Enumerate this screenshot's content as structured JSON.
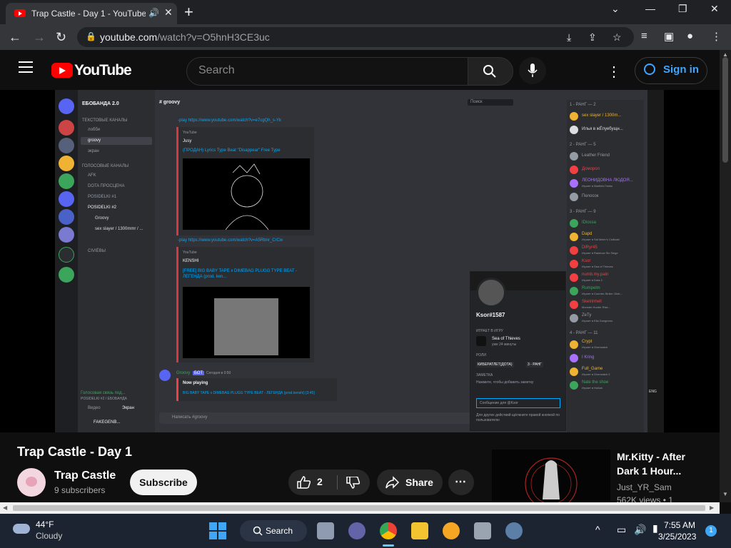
{
  "browser": {
    "tab_title": "Trap Castle - Day 1 - YouTube",
    "url_host": "youtube.com",
    "url_path": "/watch?v=O5hnH3CE3uc"
  },
  "youtube": {
    "logo_text": "YouTube",
    "search_placeholder": "Search",
    "signin_label": "Sign in"
  },
  "discord": {
    "server_name": "ЕБОБАНДА 2.0",
    "current_channel": "groovy",
    "text_category": "ТЕКСТОВЫЕ КАНАЛЫ",
    "text_channels": [
      "лобби",
      "groovy",
      "экран"
    ],
    "voice_category": "ГОЛОСОВЫЕ КАНАЛЫ",
    "voice_channels": [
      "AFK",
      "DOTA ПРОСЦЕНА",
      "POSIDELKI #1",
      "POSIDELKI #2"
    ],
    "voice_users": [
      "Groovy",
      "sex slayer / 1300mmr / ..."
    ],
    "voice_extra": "CIVIЁВЫ",
    "voice_status": "Голосовая связь под...",
    "voice_status_sub": "POSIDELKI #2 / ЕБОБАНДА",
    "video_btn": "Видео",
    "screen_btn": "Экран",
    "user_tag": "FAKEGENB...",
    "search_placeholder": "Поиск",
    "msg1_link": "-play https://www.youtube.com/watch?v=e7cgQh_s-Yk",
    "embed1_provider": "YouTube",
    "embed1_author": "Jusy",
    "embed1_title": "(ПРОДАН) Lyrics Type Beat \"Disappear\" Free Type",
    "msg2_link": "-play https://www.youtube.com/watch?v=A5Rbnr_CrCw",
    "embed2_provider": "YouTube",
    "embed2_author": "KENSHI",
    "embed2_title": "[FREE] BIG BABY TAPE x DIMEBAG PLUGG TYPE BEAT - ЛЕГЕНДА (prod. ken...",
    "bot_name": "Groovy",
    "bot_badge": "БОТ",
    "bot_time": "Сегодня в 0:50",
    "now_playing_label": "Now playing",
    "now_playing_track": "BIG BABY TAPE x DIMEBAG PLUGG TYPE BEAT - ЛЕГЕНДА (prod.kenshi) [3:45]",
    "input_placeholder": "Написать #groovy",
    "members_groups": [
      {
        "title": "1 - РАНГ — 2",
        "members": [
          {
            "name": "sex slayer / 1300m...",
            "color": "#f0b232",
            "activity": ""
          },
          {
            "name": "Илья в жЁпуебущн...",
            "color": "#dbdee1",
            "activity": ""
          }
        ]
      },
      {
        "title": "2 - РАНГ — 5",
        "members": [
          {
            "name": "Leather Friend",
            "color": "#949ba4",
            "activity": ""
          },
          {
            "name": "Доморол",
            "color": "#f23f42",
            "activity": ""
          },
          {
            "name": "ЛЕОНИДОВНА ЛЮДОЯ...",
            "color": "#a970ff",
            "activity": "Играет в Warfield Tanks"
          },
          {
            "name": "Пелосок",
            "color": "#949ba4",
            "activity": ""
          }
        ]
      },
      {
        "title": "3 - РАНГ — 9",
        "members": [
          {
            "name": "IDiossa",
            "color": "#3ba55c",
            "activity": ""
          },
          {
            "name": "Dapd",
            "color": "#f0b232",
            "activity": "Играет в Sid Meier's Civilizati"
          },
          {
            "name": "DiRyr45",
            "color": "#f23f42",
            "activity": "Играет в Rainbow Six Siege"
          },
          {
            "name": "Ksor",
            "color": "#f23f42",
            "activity": "Играет в Sea of Thieves"
          },
          {
            "name": "numb.my.pain",
            "color": "#f23f42",
            "activity": "Играет в Dota 2"
          },
          {
            "name": "Rumpelm",
            "color": "#3ba55c",
            "activity": "Играет в Counter-Strike: Glob..."
          },
          {
            "name": "Skelrinhell",
            "color": "#f23f42",
            "activity": "Monster Hunter Rise..."
          },
          {
            "name": "ZeTy",
            "color": "#949ba4",
            "activity": "Играет в Ella Dungeons"
          }
        ]
      },
      {
        "title": "4 - РАНГ — 11",
        "members": [
          {
            "name": "Crypt",
            "color": "#f0b232",
            "activity": "Играет в Overwatch"
          },
          {
            "name": "I Kring",
            "color": "#a970ff",
            "activity": ""
          },
          {
            "name": "Full_Game",
            "color": "#f0b232",
            "activity": "Играет в Overwatch 2"
          },
          {
            "name": "Nate the shoe",
            "color": "#3ba55c",
            "activity": "Играет в Hollow"
          }
        ]
      }
    ],
    "profile": {
      "username": "Ksor#1587",
      "playing_header": "ИГРАЕТ В ИГРУ",
      "game": "Sea of Thieves",
      "game_time": "уже 24 минуты",
      "roles_header": "РОЛИ",
      "roles": [
        "КИБЕРАТЛЕТ(ДОТА)",
        "3 - РАНГ"
      ],
      "note_header": "ЗАМЕТКА",
      "note_placeholder": "Нажмите, чтобы добавить заметку",
      "message_placeholder": "Сообщение для @Ksor",
      "hint": "Для других действий щёлкните правой кнопкой по пользователю"
    }
  },
  "video": {
    "title": "Trap Castle - Day 1",
    "channel": "Trap Castle",
    "subscribers": "9 subscribers",
    "subscribe_label": "Subscribe",
    "likes": "2",
    "share_label": "Share"
  },
  "recommendation": {
    "title": "Mr.Kitty - After Dark 1 Hour...",
    "channel": "Just_YR_Sam",
    "views": "562K views • 1"
  },
  "taskbar": {
    "temperature": "44°F",
    "weather": "Cloudy",
    "search_label": "Search",
    "time": "7:55 AM",
    "date": "3/25/2023",
    "notifications": "1"
  },
  "colors": {
    "youtube_red": "#ff0000",
    "link_blue": "#3ea6ff",
    "discord_bg": "#313338",
    "taskbar_bg": "#1c2431"
  }
}
